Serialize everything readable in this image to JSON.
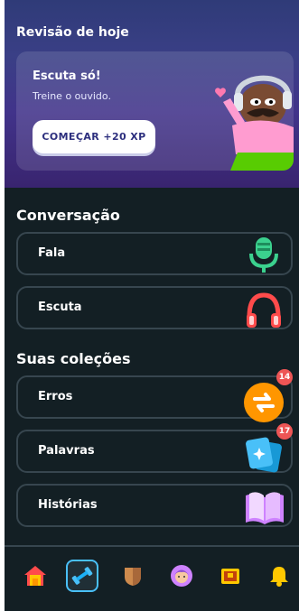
{
  "review": {
    "title": "Revisão de hoje",
    "card_title": "Escuta só!",
    "card_subtitle": "Treine o ouvido.",
    "button_label": "COMEÇAR +20 XP"
  },
  "conversation": {
    "title": "Conversação",
    "items": [
      {
        "label": "Fala",
        "icon": "microphone-icon"
      },
      {
        "label": "Escuta",
        "icon": "headphones-icon"
      }
    ]
  },
  "collections": {
    "title": "Suas coleções",
    "items": [
      {
        "label": "Erros",
        "icon": "repeat-icon",
        "badge": "14"
      },
      {
        "label": "Palavras",
        "icon": "cards-icon",
        "badge": "17"
      },
      {
        "label": "Histórias",
        "icon": "book-icon"
      }
    ]
  },
  "nav": {
    "items": [
      "home-icon",
      "practice-icon",
      "league-shield-icon",
      "profile-avatar-icon",
      "chest-icon",
      "bell-icon"
    ],
    "active": "practice-icon"
  },
  "colors": {
    "background": "#131f24",
    "border": "#37464f",
    "active_blue": "#49c0f8",
    "badge_red": "#ee5555"
  }
}
